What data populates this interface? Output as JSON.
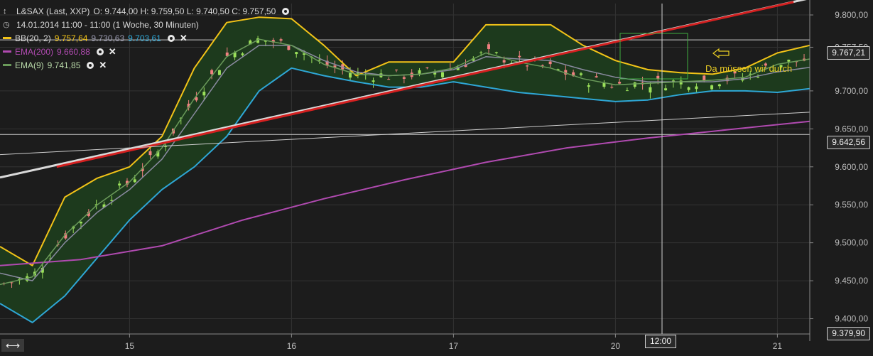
{
  "legend": {
    "instrument": "L&SAX (Last, XXP)",
    "ohlc": "O: 9.744,00  H: 9.759,50  L: 9.740,50  C: 9.757,50",
    "period": "14.01.2014 11:00 - 11:00 (1 Woche, 30 Minuten)",
    "bb_label": "BB(20, 2)",
    "bb_upper": "9.757,64",
    "bb_mid": "9.730,63",
    "bb_lower": "9.703,61",
    "ema200_label": "EMA(200)",
    "ema200_value": "9.660,88",
    "ema9_label": "EMA(9)",
    "ema9_value": "9.741,85"
  },
  "annotation": "Da müssen wir durch",
  "price_tags": {
    "resistance": "9.767,21",
    "support": "9.642,56",
    "bottom": "9.379,90"
  },
  "time_tag": "12:00",
  "colors": {
    "bb_upper": "#f2c318",
    "bb_mid": "#8a8aa0",
    "bb_lower": "#2ea7d6",
    "band_fill": "#1d3a1d",
    "ema200": "#b04ab0",
    "ema9": "#6a9a5a",
    "trend_red": "#d42020",
    "trend_white": "#d9d9d9",
    "candle_up": "#9be05a",
    "candle_down": "#f08080"
  },
  "chart_data": {
    "type": "line",
    "x_ticks": [
      "15",
      "16",
      "17",
      "20",
      "21"
    ],
    "y_ticks": [
      "9.800,00",
      "9.757,50",
      "9.700,00",
      "9.650,00",
      "9.600,00",
      "9.550,00",
      "9.500,00",
      "9.450,00",
      "9.400,00"
    ],
    "ylim": [
      9379.9,
      9815
    ],
    "grid": true,
    "x_index_range": [
      0,
      100
    ],
    "x_tick_index": [
      16,
      36,
      56,
      76,
      96
    ],
    "series": [
      {
        "name": "BB(20, 2)",
        "x": [
          0,
          4,
          8,
          12,
          16,
          20,
          24,
          28,
          32,
          36,
          40,
          44,
          48,
          52,
          56,
          60,
          64,
          68,
          72,
          76,
          80,
          84,
          88,
          92,
          96,
          100
        ],
        "values": [
          9495,
          9470,
          9560,
          9585,
          9600,
          9640,
          9730,
          9790,
          9797,
          9795,
          9760,
          9720,
          9738,
          9738,
          9738,
          9787,
          9787,
          9787,
          9760,
          9740,
          9728,
          9724,
          9722,
          9730,
          9750,
          9760
        ]
      },
      {
        "name": "",
        "x": [
          0,
          4,
          8,
          12,
          16,
          20,
          24,
          28,
          32,
          36,
          40,
          44,
          48,
          52,
          56,
          60,
          64,
          68,
          72,
          76,
          80,
          84,
          88,
          92,
          96,
          100
        ],
        "values": [
          9460,
          9450,
          9500,
          9540,
          9570,
          9610,
          9670,
          9730,
          9760,
          9760,
          9740,
          9725,
          9720,
          9722,
          9728,
          9745,
          9742,
          9740,
          9728,
          9718,
          9712,
          9712,
          9712,
          9716,
          9725,
          9731
        ]
      },
      {
        "name": "",
        "x": [
          0,
          4,
          8,
          12,
          16,
          20,
          24,
          28,
          32,
          36,
          40,
          44,
          48,
          52,
          56,
          60,
          64,
          68,
          72,
          76,
          80,
          84,
          88,
          92,
          96,
          100
        ],
        "values": [
          9420,
          9395,
          9430,
          9480,
          9530,
          9570,
          9600,
          9640,
          9700,
          9730,
          9720,
          9712,
          9705,
          9705,
          9712,
          9705,
          9698,
          9694,
          9690,
          9686,
          9688,
          9695,
          9700,
          9700,
          9698,
          9703
        ]
      },
      {
        "name": "EMA(200)",
        "x": [
          0,
          10,
          20,
          30,
          40,
          50,
          60,
          70,
          80,
          90,
          100
        ],
        "values": [
          9470,
          9478,
          9496,
          9530,
          9558,
          9583,
          9606,
          9625,
          9638,
          9649,
          9660
        ]
      },
      {
        "name": "EMA(9)",
        "x": [
          0,
          4,
          8,
          12,
          16,
          20,
          24,
          28,
          32,
          36,
          40,
          44,
          48,
          52,
          56,
          60,
          64,
          68,
          72,
          76,
          80,
          84,
          88,
          92,
          96,
          100
        ],
        "values": [
          9445,
          9455,
          9510,
          9550,
          9580,
          9625,
          9690,
          9745,
          9768,
          9760,
          9735,
          9722,
          9720,
          9722,
          9730,
          9750,
          9738,
          9730,
          9716,
          9708,
          9710,
          9712,
          9714,
          9718,
          9735,
          9742
        ]
      }
    ]
  }
}
